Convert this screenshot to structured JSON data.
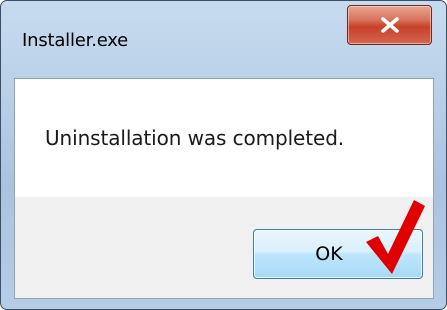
{
  "window": {
    "title": "Installer.exe"
  },
  "dialog": {
    "message": "Uninstallation was completed.",
    "ok_label": "OK"
  },
  "icons": {
    "close": "close-icon",
    "annotation": "red-checkmark-icon"
  },
  "colors": {
    "close_button": "#c7412a",
    "checkmark": "#e00000",
    "ok_button_border": "#3c7fb1"
  }
}
